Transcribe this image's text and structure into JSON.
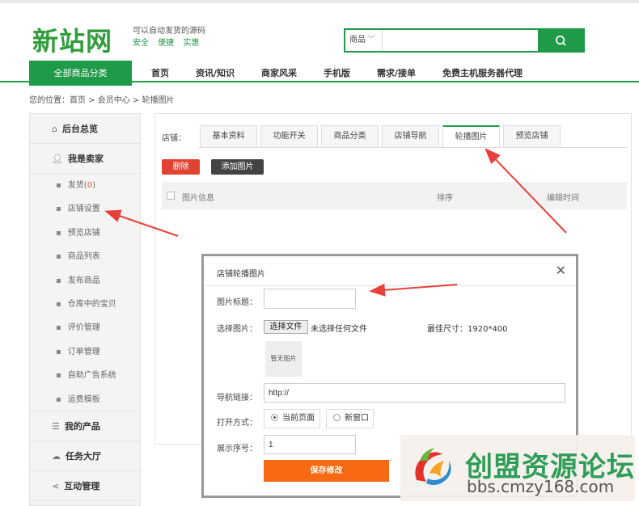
{
  "header": {
    "logo_text": "新站网",
    "slogan_line1": "可以自动发货的源码",
    "slogan_line2": "安全 便捷 实惠",
    "search": {
      "category": "商品",
      "placeholder": "",
      "button_icon": "search-icon"
    },
    "category_button": "全部商品分类",
    "nav": [
      "首页",
      "资讯/知识",
      "商家风采",
      "手机版",
      "需求/接单",
      "免费主机服务器代理"
    ]
  },
  "breadcrumb": "您的位置：首页 > 会员中心 > 轮播图片",
  "sidebar": {
    "sections": [
      {
        "label": "后台总览",
        "icon": "home-icon"
      },
      {
        "label": "我是卖家",
        "icon": "user-icon"
      }
    ],
    "items": [
      {
        "label": "发货(",
        "count": "0",
        "suffix": ")"
      },
      {
        "label": "店铺设置"
      },
      {
        "label": "预览店铺"
      },
      {
        "label": "商品列表"
      },
      {
        "label": "发布商品"
      },
      {
        "label": "仓库中的宝贝"
      },
      {
        "label": "评价管理"
      },
      {
        "label": "订单管理"
      },
      {
        "label": "自助广告系统"
      },
      {
        "label": "运费模板"
      }
    ],
    "bottom_sections": [
      {
        "label": "我的产品",
        "icon": "list-icon"
      },
      {
        "label": "任务大厅",
        "icon": "cloud-icon"
      },
      {
        "label": "互动管理",
        "icon": "share-icon"
      }
    ]
  },
  "main": {
    "tabs_label": "店铺：",
    "tabs": [
      "基本资料",
      "功能开关",
      "商品分类",
      "店铺导航",
      "轮播图片",
      "预览店铺"
    ],
    "active_tab": "轮播图片",
    "delete_button": "删除",
    "add_button": "添加图片",
    "table_headers": [
      "图片信息",
      "排序",
      "编辑时间"
    ]
  },
  "modal": {
    "title": "店铺轮播图片",
    "close_icon": "close-icon",
    "fields": {
      "title_label": "图片标题：",
      "title_value": "",
      "image_label": "选择图片：",
      "file_button": "选择文件",
      "file_status": "未选择任何文件",
      "best_size": "最佳尺寸：1920*400",
      "no_image": "暂无图片",
      "link_label": "导航链接：",
      "link_value": "http://",
      "open_label": "打开方式：",
      "open_options": [
        "当前页面",
        "新窗口"
      ],
      "open_selected": "当前页面",
      "order_label": "展示序号：",
      "order_value": "1"
    },
    "save_button": "保存修改"
  },
  "watermark": {
    "title": "创盟资源论坛",
    "url": "bbs.cmzy168.com"
  },
  "colors": {
    "brand_green": "#1f9a48",
    "danger_red": "#e14333",
    "save_orange": "#f76a13",
    "arrow_red": "#e8413b"
  }
}
